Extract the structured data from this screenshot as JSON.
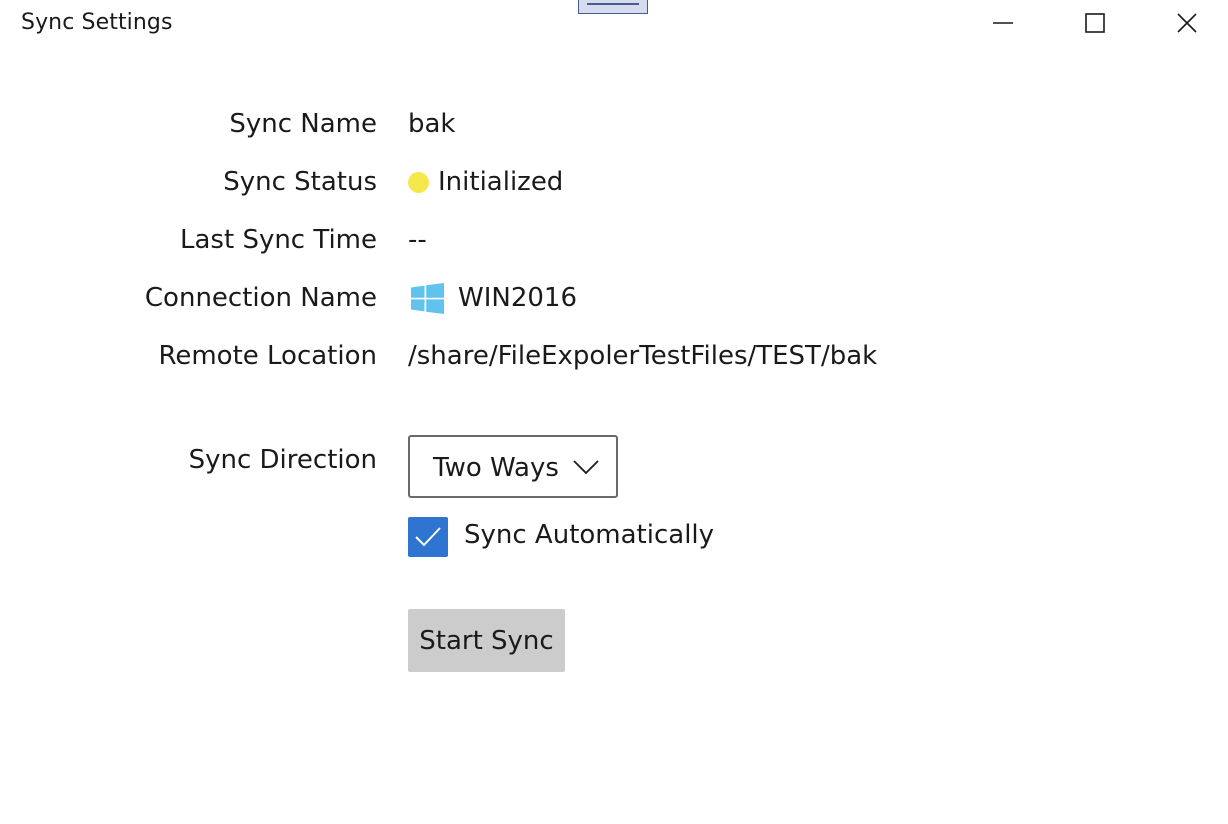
{
  "window": {
    "title": "Sync Settings"
  },
  "fields": {
    "sync_name": {
      "label": "Sync Name",
      "value": "bak"
    },
    "sync_status": {
      "label": "Sync Status",
      "value": "Initialized",
      "status_color": "#f4e84a"
    },
    "last_sync_time": {
      "label": "Last Sync Time",
      "value": "--"
    },
    "connection_name": {
      "label": "Connection Name",
      "value": "WIN2016",
      "icon": "windows-logo-icon",
      "icon_color": "#5fc3ee"
    },
    "remote_location": {
      "label": "Remote Location",
      "value": "/share/FileExpolerTestFiles/TEST/bak"
    }
  },
  "sync_direction": {
    "label": "Sync Direction",
    "selected": "Two Ways"
  },
  "sync_automatically": {
    "label": "Sync Automatically",
    "checked": true,
    "accent_color": "#2f74d0"
  },
  "start_button": {
    "label": "Start Sync"
  }
}
